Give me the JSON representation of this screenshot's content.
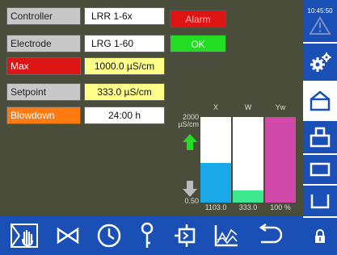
{
  "rows": [
    {
      "label": "Controller",
      "value": "LRR 1-6x",
      "label_color": "#c8c8c8",
      "value_color": "#ffffff"
    },
    {
      "label": "Electrode",
      "value": "LRG 1-60",
      "label_color": "#c8c8c8",
      "value_color": "#ffffff"
    },
    {
      "label": "Max",
      "value": "1000.0 µS/cm",
      "label_color": "#dd1515",
      "value_color": "#ffff8a"
    },
    {
      "label": "Setpoint",
      "value": "333.0 µS/cm",
      "label_color": "#c8c8c8",
      "value_color": "#ffff8a"
    },
    {
      "label": "Blowdown",
      "value": "24:00 h",
      "label_color": "#ff7a10",
      "value_color": "#ffffff"
    }
  ],
  "status": {
    "alarm_label": "Alarm",
    "alarm_color": "#dd1515",
    "ok_label": "OK",
    "ok_color": "#22dd22"
  },
  "time": "10:45:50",
  "chart_data": {
    "type": "bar",
    "categories": [
      "X",
      "W",
      "Yw"
    ],
    "values_text": [
      "1103.0",
      "333.0",
      "100 %"
    ],
    "ymax_label": "2000",
    "unit_label": "µS/cm",
    "ymin_label": "0.50",
    "fills": [
      0.46,
      0.14,
      1.0
    ],
    "colors": [
      "#1aa9e8",
      "#3ee88e",
      "#d048a8"
    ]
  },
  "icons": {
    "sidebar": [
      "warning-icon",
      "settings-gears-icon",
      "valve-panel-icon",
      "panel-top-icon",
      "panel-box-icon",
      "tray-icon"
    ],
    "bottom": [
      "manual-hand-icon",
      "valve-icon",
      "clock-icon",
      "key-icon",
      "module-icon",
      "graph-icon",
      "back-icon",
      "lock-icon"
    ]
  }
}
